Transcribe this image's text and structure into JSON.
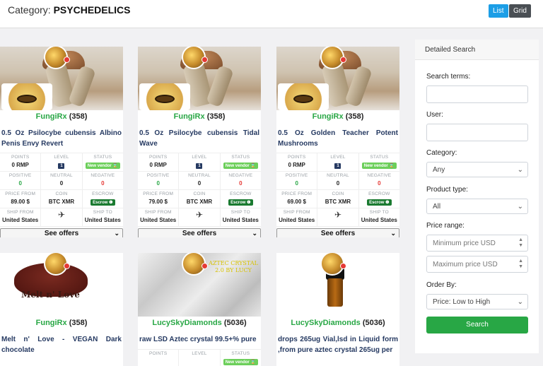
{
  "header": {
    "category_prefix": "Category: ",
    "category_name": "PSYCHEDELICS",
    "list_label": "List",
    "grid_label": "Grid"
  },
  "stat_labels": {
    "points": "POINTS",
    "level": "LEVEL",
    "status": "STATUS",
    "positive": "POSITIVE",
    "neutral": "NEUTRAL",
    "negative": "NEGATIVE",
    "price_from": "PRICE FROM",
    "coin": "COIN",
    "escrow": "ESCROW",
    "ship_from": "SHIP FROM",
    "ship_to": "SHIP TO"
  },
  "listings": [
    {
      "vendor": "FungiRx",
      "count": "(358)",
      "title": "0.5 Oz Psilocybe cubensis Albino Penis Envy Revert",
      "points": "0 RMP",
      "level": "1",
      "status": "New vendor ⌛",
      "positive": "0",
      "neutral": "0",
      "negative": "0",
      "price": "89.00 $",
      "coin": "BTC XMR",
      "escrow": "Escrow ❶",
      "ship_from": "United States",
      "ship_to": "United States",
      "offers": "See offers"
    },
    {
      "vendor": "FungiRx",
      "count": "(358)",
      "title": "0.5 Oz Psilocybe cubensis Tidal Wave",
      "points": "0 RMP",
      "level": "1",
      "status": "New vendor ⌛",
      "positive": "0",
      "neutral": "0",
      "negative": "0",
      "price": "79.00 $",
      "coin": "BTC XMR",
      "escrow": "Escrow ❶",
      "ship_from": "United States",
      "ship_to": "United States",
      "offers": "See offers"
    },
    {
      "vendor": "FungiRx",
      "count": "(358)",
      "title": "0.5 Oz Golden Teacher Potent Mushrooms",
      "points": "0 RMP",
      "level": "1",
      "status": "New vendor ⌛",
      "positive": "0",
      "neutral": "0",
      "negative": "0",
      "price": "69.00 $",
      "coin": "BTC XMR",
      "escrow": "Escrow ❶",
      "ship_from": "United States",
      "ship_to": "United States",
      "offers": "See offers"
    },
    {
      "vendor": "FungiRx",
      "count": "(358)",
      "title": "Melt n' Love - VEGAN Dark chocolate",
      "image_text": "Melt n' Love"
    },
    {
      "vendor": "LucySkyDiamonds",
      "count": "(5036)",
      "title": "raw LSD Aztec crystal 99.5+% pure",
      "image_text": "AZTEC CRYSTAL 2.0 BY LUCY",
      "status": "New vendor ⌛"
    },
    {
      "vendor": "LucySkyDiamonds",
      "count": "(5036)",
      "title": "drops 265ug Vial,lsd in Liquid form ,from pure aztec crystal 265ug per"
    }
  ],
  "sidebar": {
    "heading": "Detailed Search",
    "search_terms_label": "Search terms:",
    "search_terms_value": "",
    "user_label": "User:",
    "user_value": "",
    "category_label": "Category:",
    "category_value": "Any",
    "product_type_label": "Product type:",
    "product_type_value": "All",
    "price_range_label": "Price range:",
    "min_price_placeholder": "Minimum price USD",
    "max_price_placeholder": "Maximum price USD",
    "order_by_label": "Order By:",
    "order_by_value": "Price: Low to High",
    "search_button": "Search"
  },
  "icons": {
    "offers_chevron": "chevron-down-icon",
    "ship_icon": "airplane-icon",
    "select_chevron": "chevron-down-icon"
  },
  "colors": {
    "vendor_green": "#28a745",
    "title_navy": "#263a62",
    "list_button": "#1c9ee6",
    "grid_button": "#4a4f54",
    "search_button": "#28a745"
  }
}
